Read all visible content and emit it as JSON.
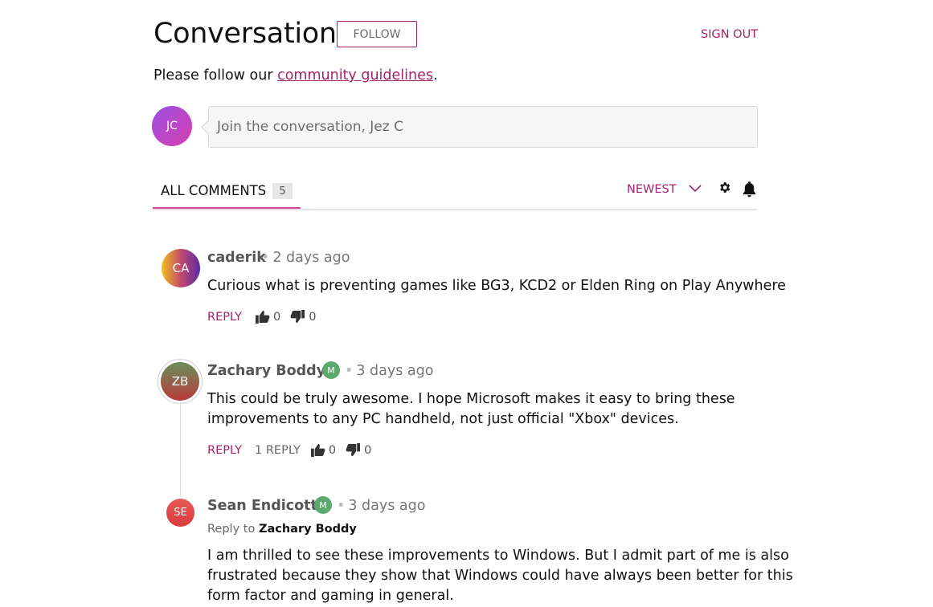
{
  "header": {
    "title": "Conversation",
    "follow_label": "FOLLOW",
    "signout_label": "SIGN OUT"
  },
  "guidelines": {
    "prefix": "Please follow our ",
    "link": "community guidelines",
    "suffix": "."
  },
  "composer": {
    "avatar_initials": "JC",
    "placeholder": "Join the conversation, Jez C"
  },
  "tabs": {
    "all_label": "ALL COMMENTS",
    "count": "5",
    "sort_label": "NEWEST",
    "settings_icon": "gear-icon",
    "notifications_icon": "bell-icon"
  },
  "colors": {
    "accent": "#a4216b",
    "tab_underline": "#d9479a",
    "moderator_badge": "#5da86f"
  },
  "comments": [
    {
      "initials": "CA",
      "author": "caderik",
      "time": "2 days ago",
      "moderator": false,
      "body": "Curious what is preventing games like BG3, KCD2 or Elden Ring on Play Anywhere",
      "reply_label": "REPLY",
      "likes": "0",
      "dislikes": "0"
    },
    {
      "initials": "ZB",
      "author": "Zachary Boddy",
      "badge": "M",
      "time": "3 days ago",
      "moderator": true,
      "body_line1": "This could be truly awesome. I hope Microsoft makes it easy to bring these",
      "body_line2": "improvements to any PC handheld, not just official \"Xbox\" devices.",
      "reply_label": "REPLY",
      "replies_label": "1 REPLY",
      "likes": "0",
      "dislikes": "0"
    },
    {
      "initials": "SE",
      "author": "Sean Endicott",
      "badge": "M",
      "time": "3 days ago",
      "moderator": true,
      "reply_to_prefix": "Reply to ",
      "reply_to": "Zachary Boddy",
      "body_line1": "I am thrilled to see these improvements to Windows. But I admit part of me is also",
      "body_line2": "frustrated because they show that Windows could have always been better for this",
      "body_line3": "form factor and gaming in general."
    }
  ]
}
